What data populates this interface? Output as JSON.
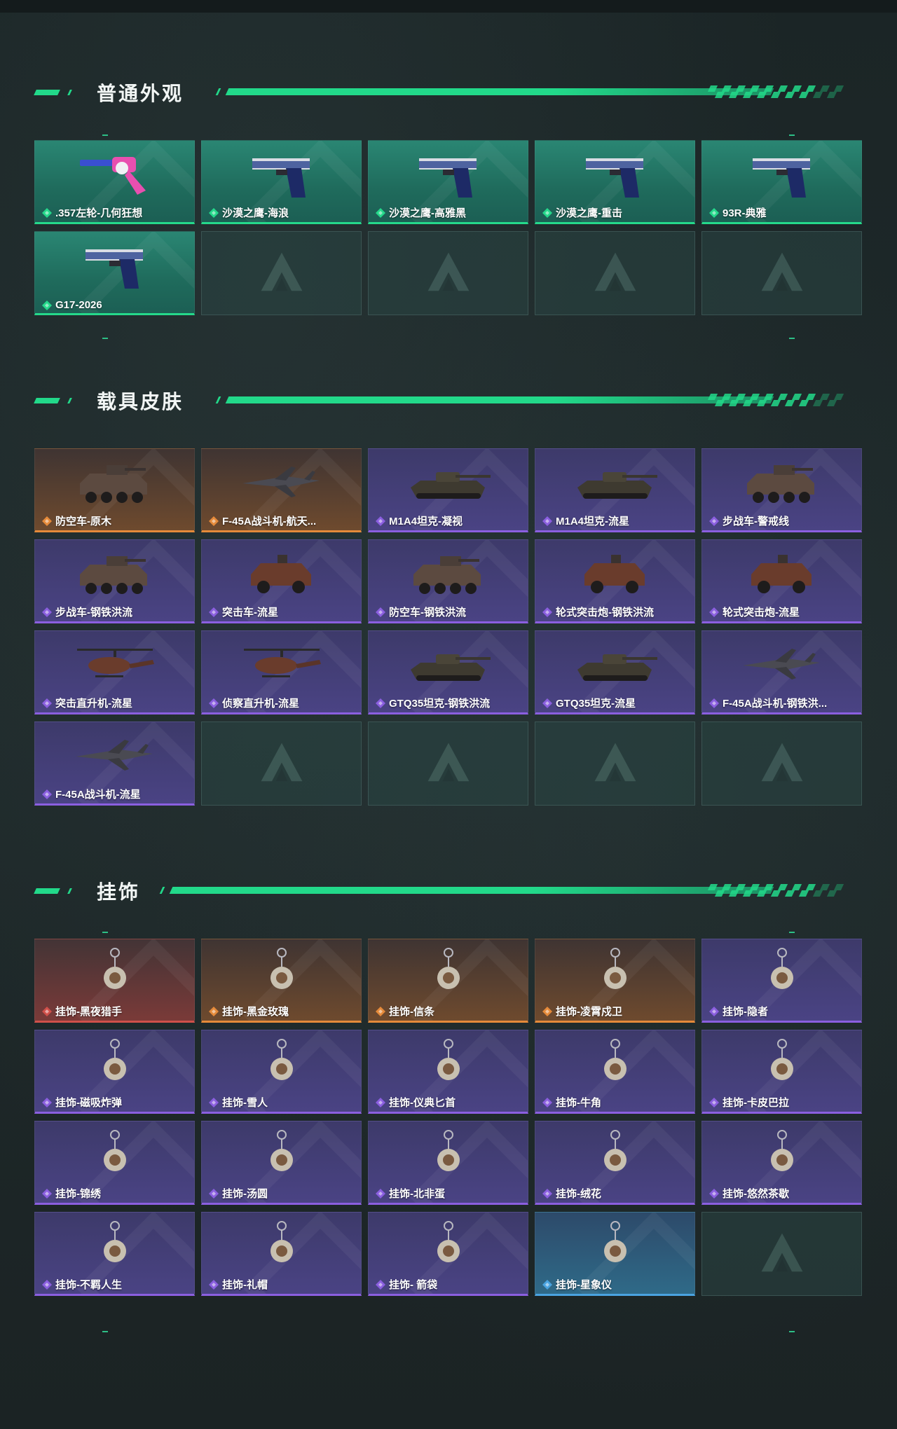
{
  "colors": {
    "accent": "#22d98a",
    "rarity_green": "#25d98b",
    "rarity_purple": "#8b5fe0",
    "rarity_orange": "#e58a3a",
    "rarity_red": "#d0504a",
    "rarity_blue": "#4aa3e0"
  },
  "sections": [
    {
      "title": "普通外观",
      "items": [
        {
          "label": ".357左轮-几何狂想",
          "rarity": "green",
          "icon": "revolver-icon"
        },
        {
          "label": "沙漠之鹰-海浪",
          "rarity": "green",
          "icon": "pistol-icon"
        },
        {
          "label": "沙漠之鹰-高雅黑",
          "rarity": "green",
          "icon": "pistol-icon"
        },
        {
          "label": "沙漠之鹰-重击",
          "rarity": "green",
          "icon": "pistol-icon"
        },
        {
          "label": "93R-典雅",
          "rarity": "green",
          "icon": "pistol-icon"
        },
        {
          "label": "G17-2026",
          "rarity": "green",
          "icon": "pistol-icon"
        }
      ]
    },
    {
      "title": "载具皮肤",
      "items": [
        {
          "label": "防空车-原木",
          "rarity": "orange",
          "icon": "apc-icon"
        },
        {
          "label": "F-45A战斗机-航天...",
          "rarity": "orange",
          "icon": "jet-icon"
        },
        {
          "label": "M1A4坦克-凝视",
          "rarity": "purple",
          "icon": "tank-icon"
        },
        {
          "label": "M1A4坦克-流星",
          "rarity": "purple",
          "icon": "tank-icon"
        },
        {
          "label": "步战车-警戒线",
          "rarity": "purple",
          "icon": "apc-icon"
        },
        {
          "label": "步战车-钢铁洪流",
          "rarity": "purple",
          "icon": "apc-icon"
        },
        {
          "label": "突击车-流星",
          "rarity": "purple",
          "icon": "truck-icon"
        },
        {
          "label": "防空车-钢铁洪流",
          "rarity": "purple",
          "icon": "apc-icon"
        },
        {
          "label": "轮式突击炮-钢铁洪流",
          "rarity": "purple",
          "icon": "truck-icon"
        },
        {
          "label": "轮式突击炮-流星",
          "rarity": "purple",
          "icon": "truck-icon"
        },
        {
          "label": "突击直升机-流星",
          "rarity": "purple",
          "icon": "helicopter-icon"
        },
        {
          "label": "侦察直升机-流星",
          "rarity": "purple",
          "icon": "helicopter-icon"
        },
        {
          "label": "GTQ35坦克-钢铁洪流",
          "rarity": "purple",
          "icon": "tank-icon"
        },
        {
          "label": "GTQ35坦克-流星",
          "rarity": "purple",
          "icon": "tank-icon"
        },
        {
          "label": "F-45A战斗机-钢铁洪...",
          "rarity": "purple",
          "icon": "jet-icon"
        },
        {
          "label": "F-45A战斗机-流星",
          "rarity": "purple",
          "icon": "jet-icon"
        }
      ]
    },
    {
      "title": "挂饰",
      "items": [
        {
          "label": "挂饰-黑夜猎手",
          "rarity": "red",
          "icon": "charm-icon"
        },
        {
          "label": "挂饰-黑金玫瑰",
          "rarity": "orange",
          "icon": "charm-icon"
        },
        {
          "label": "挂饰-信条",
          "rarity": "orange",
          "icon": "charm-icon"
        },
        {
          "label": "挂饰-凌霄戍卫",
          "rarity": "orange",
          "icon": "charm-icon"
        },
        {
          "label": "挂饰-隐者",
          "rarity": "purple",
          "icon": "charm-icon"
        },
        {
          "label": "挂饰-磁吸炸弹",
          "rarity": "purple",
          "icon": "charm-icon"
        },
        {
          "label": "挂饰-雪人",
          "rarity": "purple",
          "icon": "charm-icon"
        },
        {
          "label": "挂饰-仪典匕首",
          "rarity": "purple",
          "icon": "charm-icon"
        },
        {
          "label": "挂饰-牛角",
          "rarity": "purple",
          "icon": "charm-icon"
        },
        {
          "label": "挂饰-卡皮巴拉",
          "rarity": "purple",
          "icon": "charm-icon"
        },
        {
          "label": "挂饰-锦绣",
          "rarity": "purple",
          "icon": "charm-icon"
        },
        {
          "label": "挂饰-汤圆",
          "rarity": "purple",
          "icon": "charm-icon"
        },
        {
          "label": "挂饰-北非蛋",
          "rarity": "purple",
          "icon": "charm-icon"
        },
        {
          "label": "挂饰-绒花",
          "rarity": "purple",
          "icon": "charm-icon"
        },
        {
          "label": "挂饰-悠然茶歇",
          "rarity": "purple",
          "icon": "charm-icon"
        },
        {
          "label": "挂饰-不羁人生",
          "rarity": "purple",
          "icon": "charm-icon"
        },
        {
          "label": "挂饰-礼帽",
          "rarity": "purple",
          "icon": "charm-icon"
        },
        {
          "label": "挂饰- 箭袋",
          "rarity": "purple",
          "icon": "charm-icon"
        },
        {
          "label": "挂饰-星象仪",
          "rarity": "blue",
          "icon": "charm-icon"
        }
      ]
    }
  ]
}
